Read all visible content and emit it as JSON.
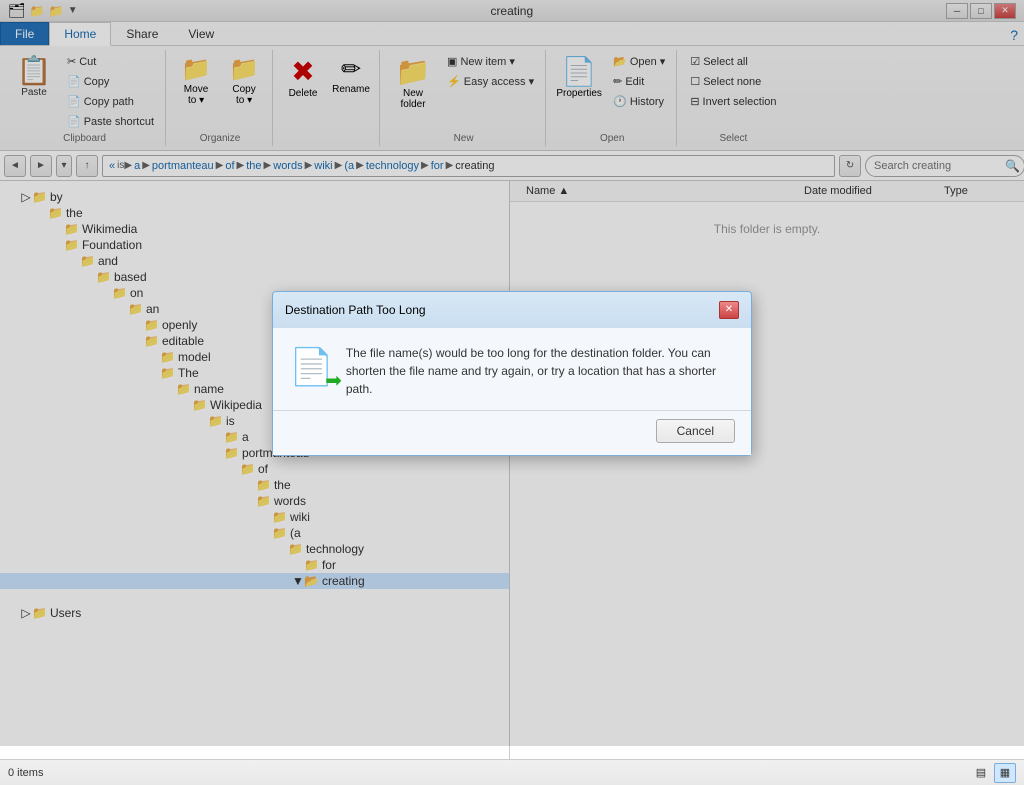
{
  "titleBar": {
    "title": "creating",
    "controls": {
      "minimize": "─",
      "restore": "□",
      "close": "✕"
    }
  },
  "ribbon": {
    "tabs": [
      {
        "id": "file",
        "label": "File",
        "class": "file-tab"
      },
      {
        "id": "home",
        "label": "Home",
        "class": "active"
      },
      {
        "id": "share",
        "label": "Share"
      },
      {
        "id": "view",
        "label": "View"
      }
    ],
    "groups": {
      "clipboard": {
        "label": "Clipboard",
        "items": [
          {
            "id": "copy",
            "icon": "📋",
            "label": "Copy",
            "size": "large"
          },
          {
            "id": "paste",
            "icon": "📋",
            "label": "Paste",
            "size": "large"
          },
          {
            "id": "cut",
            "icon": "✂",
            "label": "Cut",
            "size": "small"
          },
          {
            "id": "copypath",
            "label": "Copy path",
            "size": "small"
          },
          {
            "id": "pasteshortcut",
            "label": "Paste shortcut",
            "size": "small"
          }
        ]
      },
      "organize": {
        "label": "Organize",
        "items": [
          {
            "id": "moveto",
            "icon": "📁",
            "label": "Move to ▾",
            "size": "large"
          },
          {
            "id": "copyto",
            "icon": "📁",
            "label": "Copy to ▾",
            "size": "large"
          }
        ]
      },
      "delete": {
        "label": "",
        "items": [
          {
            "id": "delete",
            "icon": "✖",
            "label": "Delete",
            "size": "large"
          },
          {
            "id": "rename",
            "icon": "✏",
            "label": "Rename",
            "size": "large"
          }
        ]
      },
      "new": {
        "label": "New",
        "items": [
          {
            "id": "newfolder",
            "icon": "📁",
            "label": "New folder",
            "size": "large"
          },
          {
            "id": "newitem",
            "label": "New item ▾",
            "size": "small"
          },
          {
            "id": "easyaccess",
            "label": "Easy access ▾",
            "size": "small"
          }
        ]
      },
      "open": {
        "label": "Open",
        "items": [
          {
            "id": "properties",
            "icon": "📄",
            "label": "Properties",
            "size": "large"
          },
          {
            "id": "openitem",
            "label": "Open ▾",
            "size": "small"
          },
          {
            "id": "edit",
            "label": "Edit",
            "size": "small"
          },
          {
            "id": "history",
            "label": "History",
            "size": "small"
          }
        ]
      },
      "select": {
        "label": "Select",
        "items": [
          {
            "id": "selectall",
            "label": "Select all",
            "size": "small"
          },
          {
            "id": "selectnone",
            "label": "Select none",
            "size": "small"
          },
          {
            "id": "invertselection",
            "label": "Invert selection",
            "size": "small"
          }
        ]
      }
    }
  },
  "addressBar": {
    "backBtn": "◄",
    "forwardBtn": "►",
    "upBtn": "▲",
    "recentBtn": "▼",
    "pathSegments": [
      "is",
      "a",
      "portmanteau",
      "of",
      "the",
      "words",
      "wiki",
      "(a",
      "technology",
      "for",
      "creating"
    ],
    "searchPlaceholder": "Search creating",
    "refreshBtn": "↻"
  },
  "treePanel": {
    "items": [
      {
        "indent": 1,
        "label": "by",
        "exp": "▷"
      },
      {
        "indent": 2,
        "label": "the",
        "exp": ""
      },
      {
        "indent": 3,
        "label": "Wikimedia",
        "exp": ""
      },
      {
        "indent": 3,
        "label": "Foundation",
        "exp": ""
      },
      {
        "indent": 4,
        "label": "and",
        "exp": ""
      },
      {
        "indent": 5,
        "label": "based",
        "exp": ""
      },
      {
        "indent": 6,
        "label": "on",
        "exp": ""
      },
      {
        "indent": 7,
        "label": "an",
        "exp": ""
      },
      {
        "indent": 8,
        "label": "openly",
        "exp": ""
      },
      {
        "indent": 8,
        "label": "editable",
        "exp": ""
      },
      {
        "indent": 9,
        "label": "model",
        "exp": ""
      },
      {
        "indent": 9,
        "label": "The",
        "exp": ""
      },
      {
        "indent": 10,
        "label": "name",
        "exp": ""
      },
      {
        "indent": 11,
        "label": "Wikipedia",
        "exp": ""
      },
      {
        "indent": 12,
        "label": "is",
        "exp": ""
      },
      {
        "indent": 13,
        "label": "a",
        "exp": ""
      },
      {
        "indent": 13,
        "label": "portmanteau",
        "exp": ""
      },
      {
        "indent": 14,
        "label": "of",
        "exp": ""
      },
      {
        "indent": 15,
        "label": "the",
        "exp": ""
      },
      {
        "indent": 15,
        "label": "words",
        "exp": ""
      },
      {
        "indent": 16,
        "label": "wiki",
        "exp": ""
      },
      {
        "indent": 16,
        "label": "(a",
        "exp": ""
      },
      {
        "indent": 17,
        "label": "technology",
        "exp": ""
      },
      {
        "indent": 18,
        "label": "for",
        "exp": ""
      },
      {
        "indent": 18,
        "label": "creating",
        "exp": "▼",
        "selected": true
      }
    ],
    "bottomItem": {
      "label": "Users",
      "indent": 1
    }
  },
  "filePanel": {
    "columns": [
      {
        "id": "name",
        "label": "Name"
      },
      {
        "id": "dateModified",
        "label": "Date modified"
      },
      {
        "id": "type",
        "label": "Type"
      }
    ],
    "emptyMessage": "This folder is empty."
  },
  "statusBar": {
    "itemCount": "0 items",
    "viewButtons": [
      "▤",
      "▦"
    ]
  },
  "dialog": {
    "title": "Destination Path Too Long",
    "message": "The file name(s) would be too long for the destination folder. You can shorten the file name and try again, or try a location that has a shorter path.",
    "cancelLabel": "Cancel"
  }
}
